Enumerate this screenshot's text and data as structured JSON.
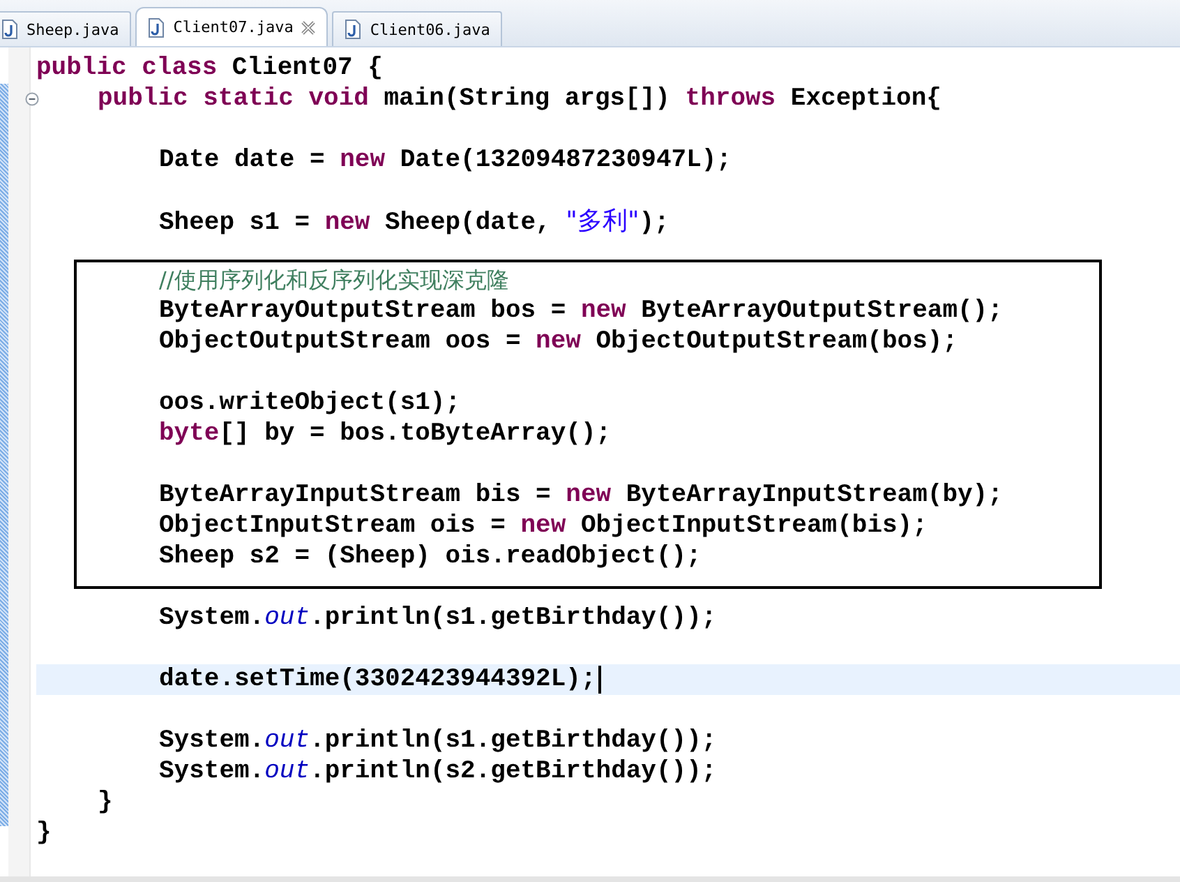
{
  "tabs": [
    {
      "label": "Sheep.java",
      "selected": false,
      "closable": false
    },
    {
      "label": "Client07.java",
      "selected": true,
      "closable": true
    },
    {
      "label": "Client06.java",
      "selected": false,
      "closable": false
    }
  ],
  "code": [
    {
      "kind": "line",
      "segments": [
        {
          "kind": "keyword",
          "text": "public"
        },
        {
          "kind": "keyword",
          "text": " class"
        },
        {
          "kind": "plain",
          "text": " Client07 {"
        }
      ],
      "children": [
        {
          "kind": "line",
          "folded": false,
          "segments": [
            {
              "kind": "keyword",
              "text": "public"
            },
            {
              "kind": "keyword",
              "text": " static"
            },
            {
              "kind": "keyword",
              "text": " void"
            },
            {
              "kind": "plain",
              "text": " main(String args[]) "
            },
            {
              "kind": "keyword",
              "text": "throws"
            },
            {
              "kind": "plain",
              "text": " Exception{"
            }
          ],
          "children": [
            {
              "kind": "blank"
            },
            {
              "kind": "line",
              "current": false,
              "segments": [
                {
                  "kind": "plain",
                  "text": "Date date = "
                },
                {
                  "kind": "keyword",
                  "text": "new"
                },
                {
                  "kind": "plain",
                  "text": " Date(13209487230947L);"
                }
              ]
            },
            {
              "kind": "blank"
            },
            {
              "kind": "line",
              "current": false,
              "segments": [
                {
                  "kind": "plain",
                  "text": "Sheep s1 = "
                },
                {
                  "kind": "keyword",
                  "text": "new"
                },
                {
                  "kind": "plain",
                  "text": " Sheep(date, "
                },
                {
                  "kind": "string",
                  "text": "\"多利\""
                },
                {
                  "kind": "plain",
                  "text": ");"
                }
              ]
            },
            {
              "kind": "blank"
            },
            {
              "kind": "boxed",
              "children": [
                {
                  "kind": "line",
                  "current": false,
                  "segments": [
                    {
                      "kind": "comment",
                      "text": "//使用序列化和反序列化实现深克隆"
                    }
                  ]
                },
                {
                  "kind": "line",
                  "current": false,
                  "segments": [
                    {
                      "kind": "plain",
                      "text": "ByteArrayOutputStream bos = "
                    },
                    {
                      "kind": "keyword",
                      "text": "new"
                    },
                    {
                      "kind": "plain",
                      "text": " ByteArrayOutputStream();"
                    }
                  ]
                },
                {
                  "kind": "line",
                  "current": false,
                  "segments": [
                    {
                      "kind": "plain",
                      "text": "ObjectOutputStream oos = "
                    },
                    {
                      "kind": "keyword",
                      "text": "new"
                    },
                    {
                      "kind": "plain",
                      "text": " ObjectOutputStream(bos);"
                    }
                  ]
                },
                {
                  "kind": "blank"
                },
                {
                  "kind": "line",
                  "current": false,
                  "segments": [
                    {
                      "kind": "plain",
                      "text": "oos.writeObject(s1);"
                    }
                  ]
                },
                {
                  "kind": "line",
                  "current": false,
                  "segments": [
                    {
                      "kind": "keyword",
                      "text": "byte"
                    },
                    {
                      "kind": "plain",
                      "text": "[] by = bos.toByteArray();"
                    }
                  ]
                },
                {
                  "kind": "blank"
                },
                {
                  "kind": "line",
                  "current": false,
                  "segments": [
                    {
                      "kind": "plain",
                      "text": "ByteArrayInputStream bis = "
                    },
                    {
                      "kind": "keyword",
                      "text": "new"
                    },
                    {
                      "kind": "plain",
                      "text": " ByteArrayInputStream(by);"
                    }
                  ]
                },
                {
                  "kind": "line",
                  "current": false,
                  "segments": [
                    {
                      "kind": "plain",
                      "text": "ObjectInputStream ois = "
                    },
                    {
                      "kind": "keyword",
                      "text": "new"
                    },
                    {
                      "kind": "plain",
                      "text": " ObjectInputStream(bis);"
                    }
                  ]
                },
                {
                  "kind": "line",
                  "current": false,
                  "segments": [
                    {
                      "kind": "plain",
                      "text": "Sheep s2 = (Sheep) ois.readObject();"
                    }
                  ]
                }
              ]
            },
            {
              "kind": "blank"
            },
            {
              "kind": "line",
              "current": false,
              "segments": [
                {
                  "kind": "plain",
                  "text": "System."
                },
                {
                  "kind": "field",
                  "text": "out"
                },
                {
                  "kind": "plain",
                  "text": ".println(s1.getBirthday());"
                }
              ]
            },
            {
              "kind": "blank"
            },
            {
              "kind": "line",
              "current": true,
              "segments": [
                {
                  "kind": "plain",
                  "text": "date.setTime(3302423944392L);"
                }
              ]
            },
            {
              "kind": "blank"
            },
            {
              "kind": "line",
              "current": false,
              "segments": [
                {
                  "kind": "plain",
                  "text": "System."
                },
                {
                  "kind": "field",
                  "text": "out"
                },
                {
                  "kind": "plain",
                  "text": ".println(s1.getBirthday());"
                }
              ]
            },
            {
              "kind": "line",
              "current": false,
              "segments": [
                {
                  "kind": "plain",
                  "text": "System."
                },
                {
                  "kind": "field",
                  "text": "out"
                },
                {
                  "kind": "plain",
                  "text": ".println(s2.getBirthday());"
                }
              ]
            }
          ]
        },
        {
          "kind": "line",
          "segments": [
            {
              "kind": "plain",
              "text": "}"
            }
          ]
        }
      ]
    },
    {
      "kind": "line",
      "segments": [
        {
          "kind": "plain",
          "text": "}"
        }
      ]
    }
  ]
}
